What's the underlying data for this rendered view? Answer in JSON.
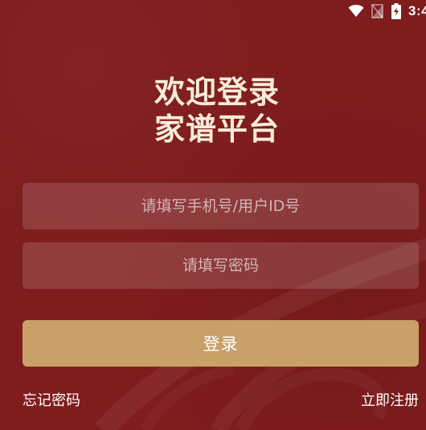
{
  "status_bar": {
    "time": "3:4",
    "icons": [
      "wifi-icon",
      "signal-icon",
      "battery-charging-icon"
    ]
  },
  "title": {
    "line1": "欢迎登录",
    "line2": "家谱平台"
  },
  "form": {
    "phone_placeholder": "请填写手机号/用户ID号",
    "phone_value": "",
    "password_placeholder": "请填写密码",
    "password_value": ""
  },
  "login_button_label": "登录",
  "links": {
    "forgot_password": "忘记密码",
    "register": "立即注册"
  },
  "colors": {
    "background": "#7f1c1e",
    "title_text": "#f7ecd8",
    "button": "#c9a068",
    "field_fill": "rgba(255,255,255,0.14)"
  }
}
